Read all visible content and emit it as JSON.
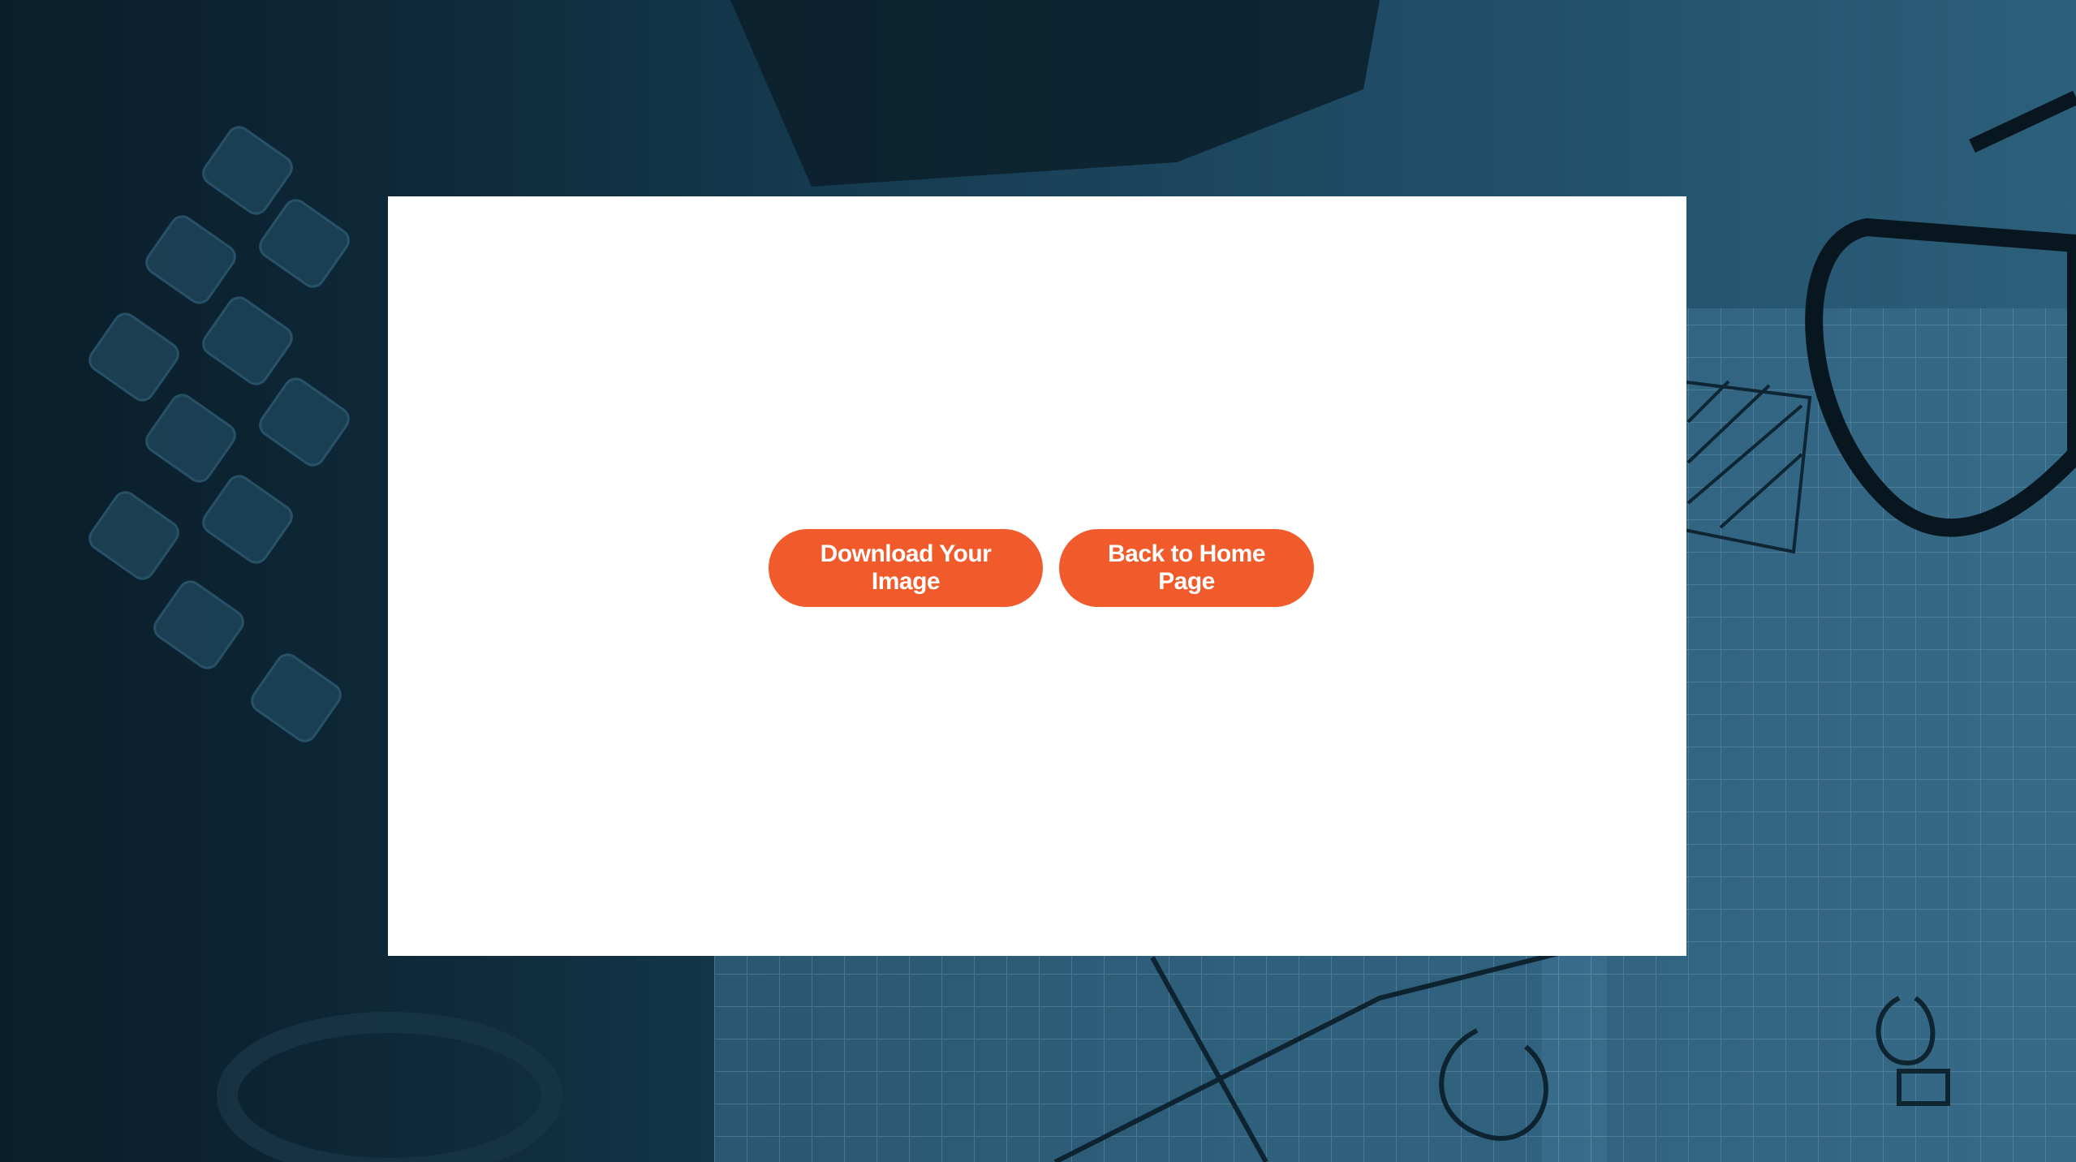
{
  "colors": {
    "accent": "#f15a2b",
    "panel": "#ffffff",
    "backdrop_dark": "#0d2433",
    "backdrop_light": "#2a5d78"
  },
  "actions": {
    "download_label": "Download Your Image",
    "home_label": "Back to Home Page"
  },
  "background": {
    "description_icon": "desk-photo-background"
  }
}
